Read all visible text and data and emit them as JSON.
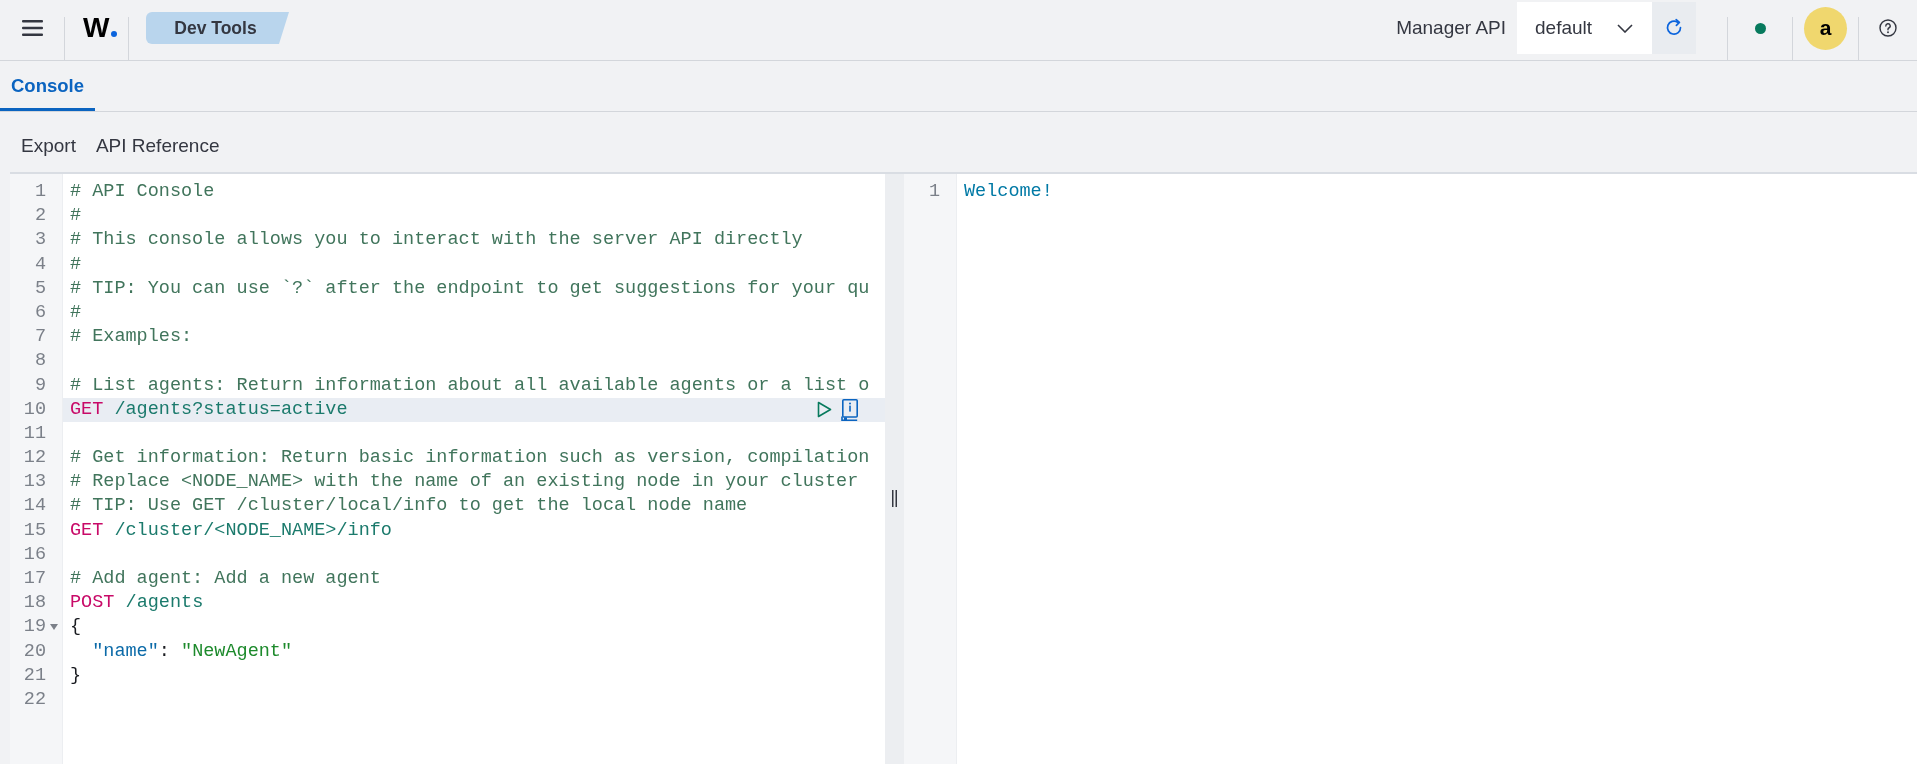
{
  "header": {
    "logo": "W",
    "app_badge": "Dev Tools",
    "api_label": "Manager API",
    "api_select": {
      "value": "default"
    },
    "avatar": "a"
  },
  "tabs": [
    {
      "label": "Console",
      "selected": true
    }
  ],
  "toolbar": [
    "Export",
    "API Reference"
  ],
  "request_editor": {
    "lines": [
      {
        "number": "1",
        "selected": false,
        "tokens": [
          {
            "kind": "comment",
            "text": "# API Console"
          }
        ]
      },
      {
        "number": "2",
        "selected": false,
        "tokens": [
          {
            "kind": "comment",
            "text": "#"
          }
        ]
      },
      {
        "number": "3",
        "selected": false,
        "tokens": [
          {
            "kind": "comment",
            "text": "# This console allows you to interact with the server API directly"
          }
        ]
      },
      {
        "number": "4",
        "selected": false,
        "tokens": [
          {
            "kind": "comment",
            "text": "#"
          }
        ]
      },
      {
        "number": "5",
        "selected": false,
        "tokens": [
          {
            "kind": "comment",
            "text": "# TIP: You can use `?` after the endpoint to get suggestions for your qu"
          }
        ]
      },
      {
        "number": "6",
        "selected": false,
        "tokens": [
          {
            "kind": "comment",
            "text": "#"
          }
        ]
      },
      {
        "number": "7",
        "selected": false,
        "tokens": [
          {
            "kind": "comment",
            "text": "# Examples:"
          }
        ]
      },
      {
        "number": "8",
        "selected": false
      },
      {
        "number": "9",
        "selected": false,
        "tokens": [
          {
            "kind": "comment",
            "text": "# List agents: Return information about all available agents or a list o"
          }
        ]
      },
      {
        "number": "10",
        "selected": true,
        "tokens": [
          {
            "kind": "method",
            "text": "GET"
          },
          {
            "kind": "url",
            "text": " /agents?status=active"
          }
        ]
      },
      {
        "number": "11",
        "selected": false
      },
      {
        "number": "12",
        "selected": false,
        "tokens": [
          {
            "kind": "comment",
            "text": "# Get information: Return basic information such as version, compilation"
          }
        ]
      },
      {
        "number": "13",
        "selected": false,
        "tokens": [
          {
            "kind": "comment",
            "text": "# Replace <NODE_NAME> with the name of an existing node in your cluster"
          }
        ]
      },
      {
        "number": "14",
        "selected": false,
        "tokens": [
          {
            "kind": "comment",
            "text": "# TIP: Use GET /cluster/local/info to get the local node name"
          }
        ]
      },
      {
        "number": "15",
        "selected": false,
        "tokens": [
          {
            "kind": "method",
            "text": "GET"
          },
          {
            "kind": "url",
            "text": " /cluster/<NODE_NAME>/info"
          }
        ]
      },
      {
        "number": "16",
        "selected": false
      },
      {
        "number": "17",
        "selected": false,
        "tokens": [
          {
            "kind": "comment",
            "text": "# Add agent: Add a new agent"
          }
        ]
      },
      {
        "number": "18",
        "selected": false,
        "tokens": [
          {
            "kind": "method",
            "text": "POST"
          },
          {
            "kind": "url",
            "text": " /agents"
          }
        ]
      },
      {
        "number": "19",
        "selected": false,
        "expanded": true,
        "tokens": [
          {
            "kind": "brace",
            "text": "{"
          }
        ]
      },
      {
        "number": "20",
        "selected": false,
        "tokens": [
          {
            "kind": "key",
            "text": "  \"name\""
          },
          {
            "kind": "punct",
            "text": ": "
          },
          {
            "kind": "string",
            "text": "\"NewAgent\""
          }
        ]
      },
      {
        "number": "21",
        "selected": false,
        "tokens": [
          {
            "kind": "brace",
            "text": "}"
          }
        ]
      },
      {
        "number": "22",
        "selected": false
      }
    ]
  },
  "response_editor": {
    "lines": [
      {
        "number": "1",
        "selected": false,
        "tokens": [
          {
            "kind": "output",
            "text": "Welcome!"
          }
        ]
      }
    ]
  }
}
